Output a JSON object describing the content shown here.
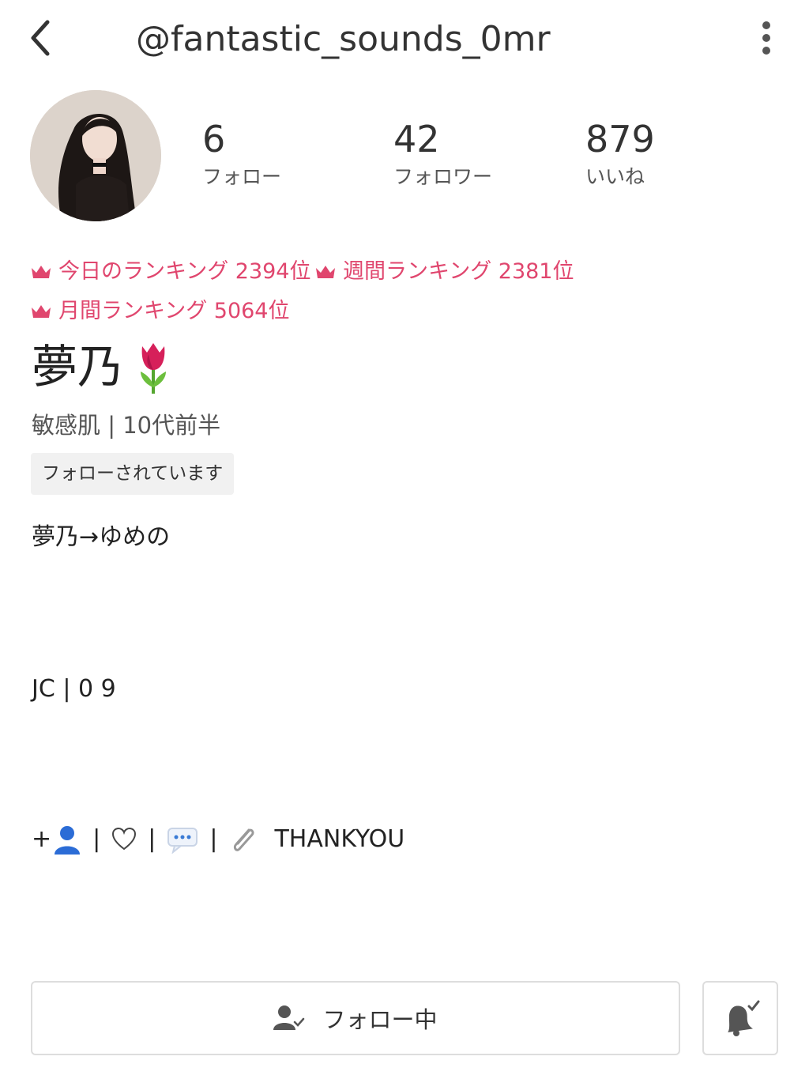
{
  "header": {
    "username": "@fantastic_sounds_0mr",
    "back_icon": "chevron-left-icon",
    "more_icon": "vertical-dots-icon"
  },
  "stats": [
    {
      "value": "6",
      "label": "フォロー"
    },
    {
      "value": "42",
      "label": "フォロワー"
    },
    {
      "value": "879",
      "label": "いいね"
    }
  ],
  "rankings": [
    {
      "text": "今日のランキング 2394位"
    },
    {
      "text": "週間ランキング 2381位"
    },
    {
      "text": "月間ランキング 5064位"
    }
  ],
  "profile": {
    "name": "夢乃",
    "emoji_icon": "tulip-icon",
    "meta": "敏感肌 | 10代前半",
    "followed_badge": "フォローされています"
  },
  "bio": {
    "line1": "夢乃→ゆめの",
    "line2": "JC |  0 9",
    "line3_prefix": "+",
    "line3_sep": "|",
    "line3_text": "THANKYOU"
  },
  "actions": {
    "follow_label": "フォロー中",
    "bell_icon": "bell-check-icon"
  },
  "colors": {
    "ranking": "#e0466e",
    "border": "#dddddd",
    "badge_bg": "#f1f1f1"
  }
}
